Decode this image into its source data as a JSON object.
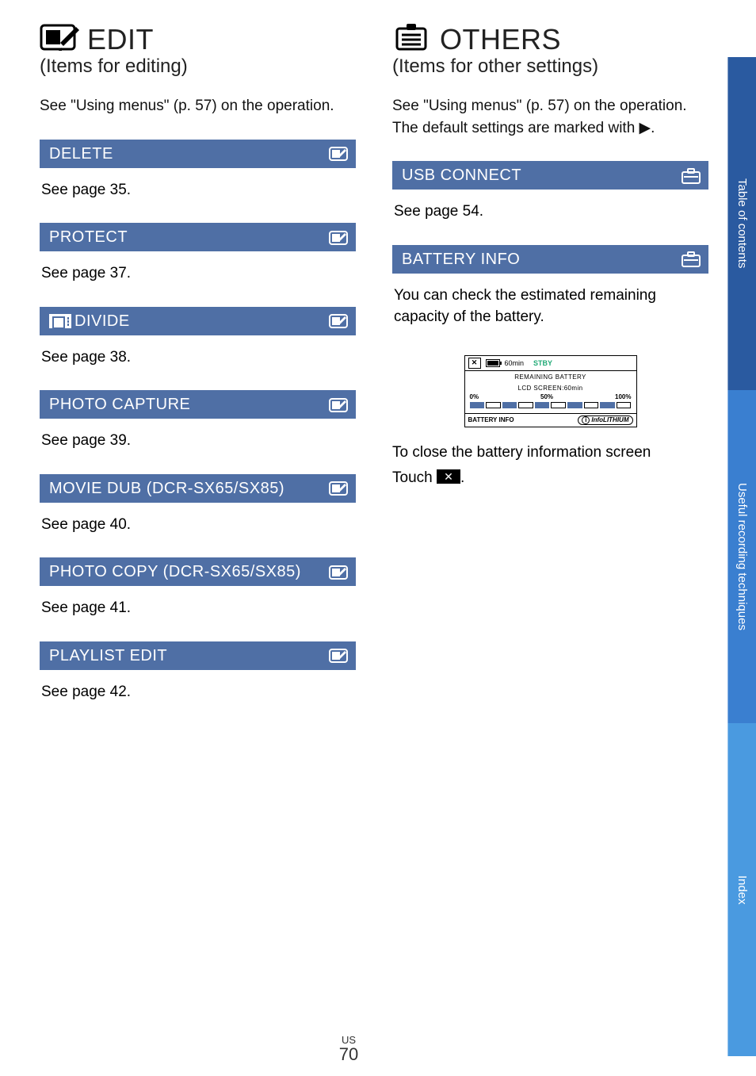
{
  "page": {
    "region": "US",
    "number": "70"
  },
  "sideTabs": {
    "toc": "Table of contents",
    "useful": "Useful recording techniques",
    "index": "Index"
  },
  "left": {
    "title": "EDIT",
    "subtitle": "(Items for editing)",
    "intro": "See \"Using menus\" (p. 57) on the operation.",
    "items": [
      {
        "label": "DELETE",
        "body": "See page 35."
      },
      {
        "label": "PROTECT",
        "body": "See page 37."
      },
      {
        "label": "DIVIDE",
        "body": "See page 38.",
        "dividePrefix": true
      },
      {
        "label": "PHOTO CAPTURE",
        "body": "See page 39."
      },
      {
        "label": "MOVIE DUB (DCR-SX65/SX85)",
        "body": "See page 40."
      },
      {
        "label": "PHOTO COPY (DCR-SX65/SX85)",
        "body": "See page 41."
      },
      {
        "label": "PLAYLIST EDIT",
        "body": "See page 42."
      }
    ]
  },
  "right": {
    "title": "OTHERS",
    "subtitle": "(Items for other settings)",
    "intro1": "See \"Using menus\" (p. 57) on the operation.",
    "intro2": "The default settings are marked with ▶.",
    "items": [
      {
        "label": "USB CONNECT",
        "body": "See page 54."
      },
      {
        "label": "BATTERY INFO",
        "body": "You can check the estimated remaining capacity of the battery."
      }
    ],
    "battery": {
      "time": "60min",
      "stby": "STBY",
      "line1": "REMAINING BATTERY",
      "line2": "LCD SCREEN:60min",
      "scale0": "0%",
      "scale50": "50%",
      "scale100": "100%",
      "footLabel": "BATTERY INFO",
      "infolithium": "InfoLITHIUM"
    },
    "closeHeading": "To close the battery information screen",
    "closeBody": "Touch ",
    "closeBodyEnd": "."
  }
}
